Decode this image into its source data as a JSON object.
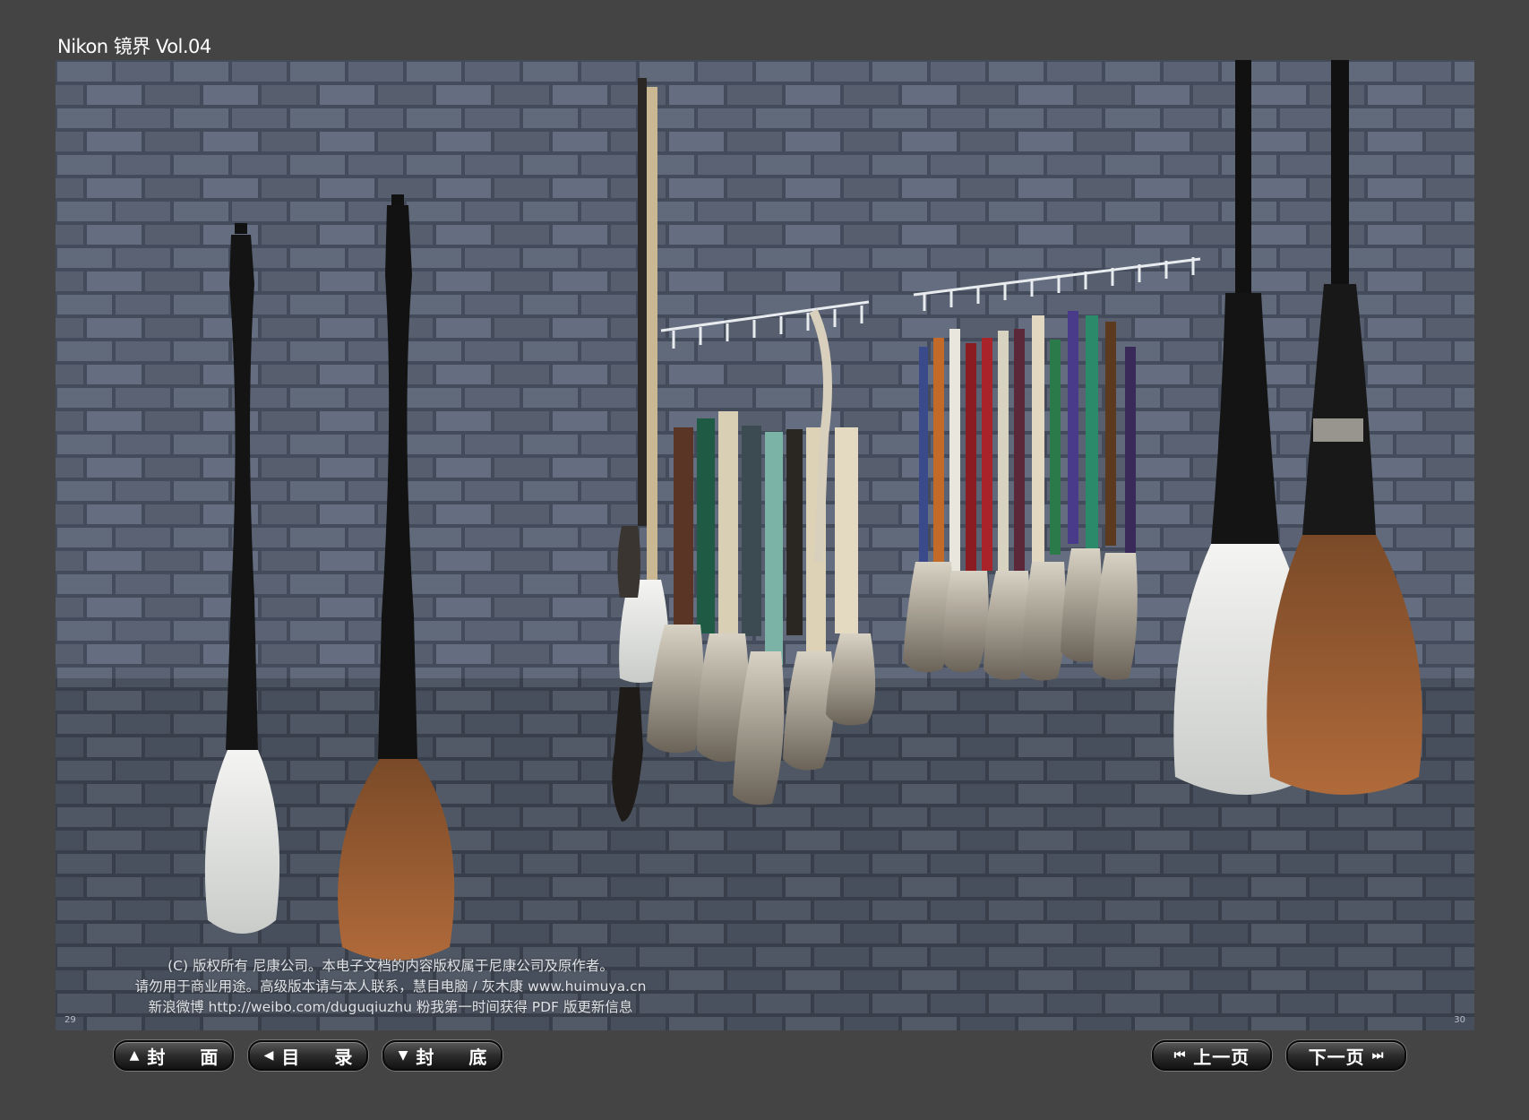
{
  "header": {
    "title": "Nikon 镜界 Vol.04"
  },
  "photo": {
    "copyright_lines": [
      "(C) 版权所有 尼康公司。本电子文档的内容版权属于尼康公司及原作者。",
      "请勿用于商业用途。高级版本请与本人联系，慧目电脑 / 灰木康 www.huimuya.cn",
      "新浪微博 http://weibo.com/duguqiuzhu  粉我第一时间获得 PDF 版更新信息"
    ],
    "page_left": "29",
    "page_right": "30"
  },
  "nav": {
    "cover": {
      "icon": "▲",
      "label": "封 面"
    },
    "toc": {
      "icon": "◀",
      "label": "目 录"
    },
    "back": {
      "icon": "▼",
      "label": "封 底"
    },
    "prev": {
      "icon": "⏮",
      "label": "上一页"
    },
    "next": {
      "icon": "⏭",
      "label": "下一页"
    }
  },
  "colors": {
    "background": "#444444",
    "wall": "#5b6475",
    "button": "#1e1e1e"
  }
}
